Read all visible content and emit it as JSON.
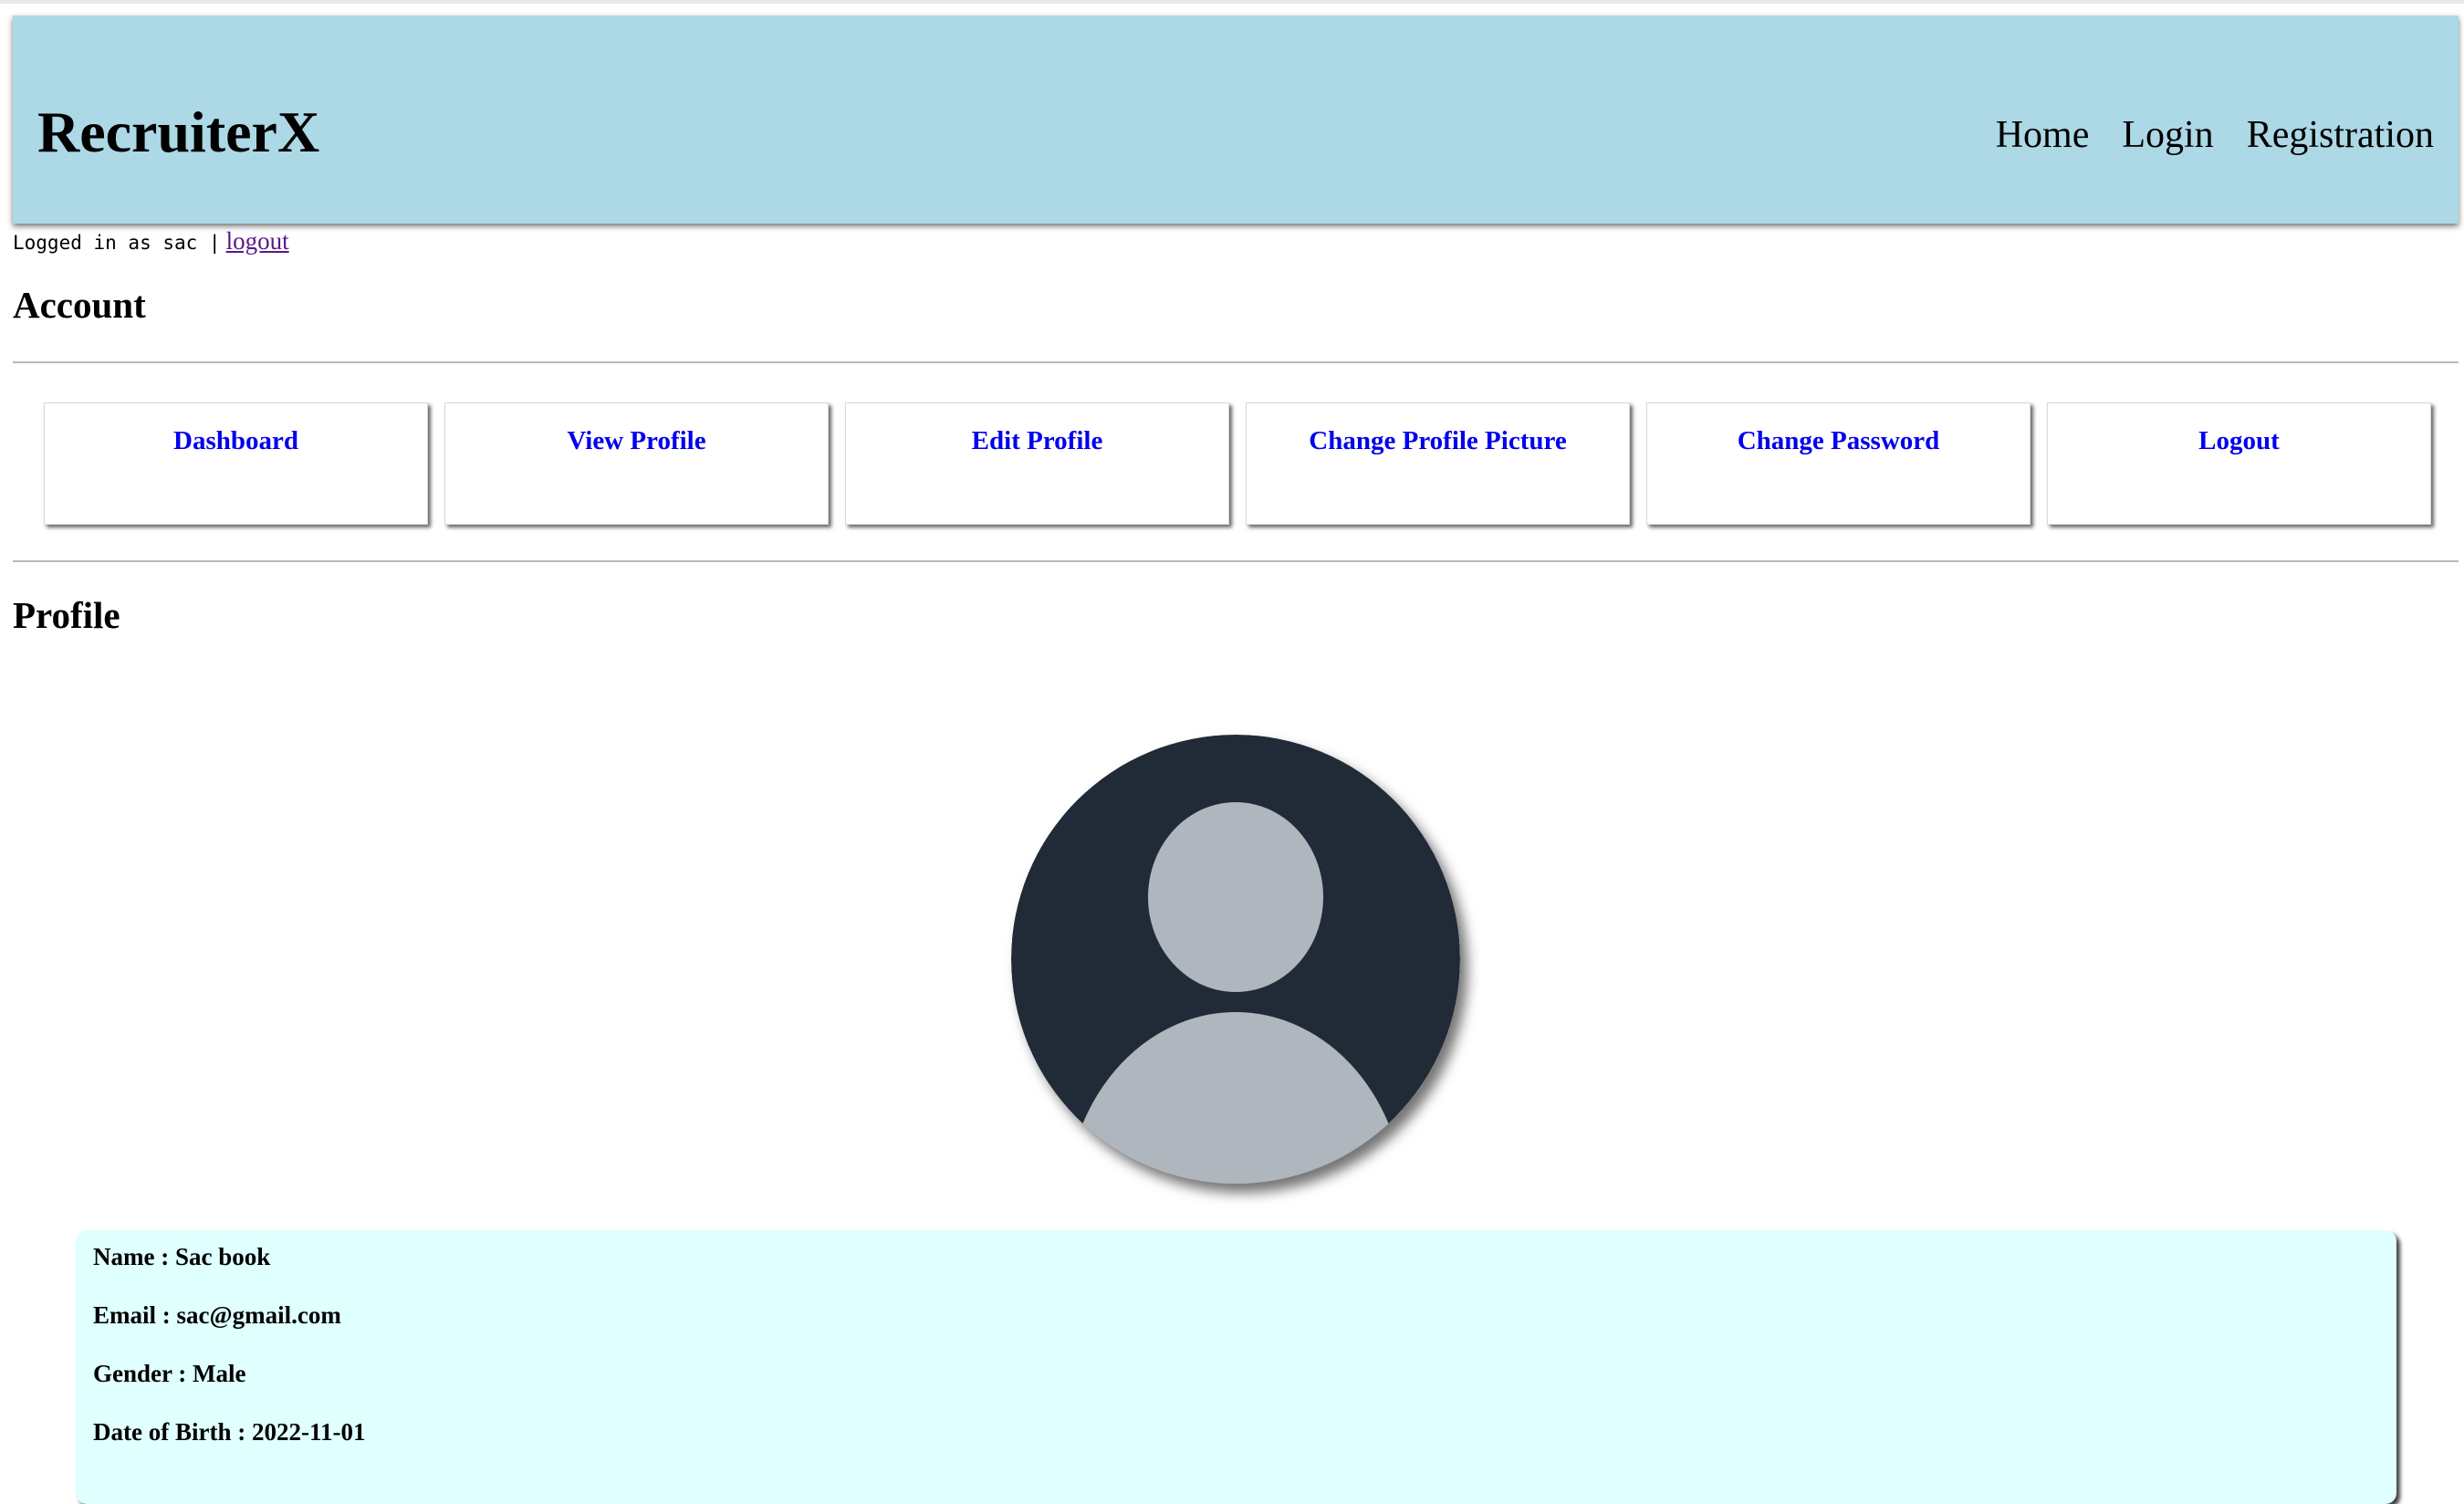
{
  "header": {
    "brand": "RecruiterX",
    "nav": [
      "Home",
      "Login",
      "Registration"
    ],
    "bg_color": "#add8e6"
  },
  "session": {
    "logged_in_text": "Logged in as sac |",
    "logout_link": "logout"
  },
  "account": {
    "heading": "Account",
    "tiles": [
      "Dashboard",
      "View Profile",
      "Edit Profile",
      "Change Profile Picture",
      "Change Password",
      "Logout"
    ],
    "link_color": "#0000ee"
  },
  "profile": {
    "heading": "Profile",
    "avatar_icon": "default-user-avatar-icon",
    "card_bg": "#e0ffff",
    "fields": [
      {
        "label": "Name",
        "value": "Sac book",
        "text": "Name : Sac book"
      },
      {
        "label": "Email",
        "value": "sac@gmail.com",
        "text": "Email : sac@gmail.com"
      },
      {
        "label": "Gender",
        "value": "Male",
        "text": "Gender : Male"
      },
      {
        "label": "Date of Birth",
        "value": "2022-11-01",
        "text": "Date of Birth : 2022-11-01"
      }
    ]
  }
}
